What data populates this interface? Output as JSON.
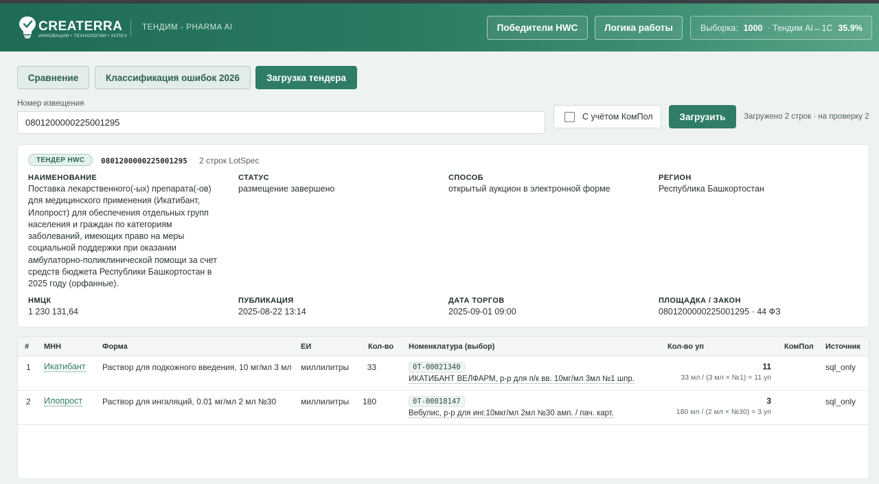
{
  "brand": {
    "logo_word": "CREATERRA",
    "logo_tagline": "ИННОВАЦИИ • ТЕХНОЛОГИИ • УСПЕХ",
    "app_subtitle": "ТЕНДИМ - PHARMA AI"
  },
  "header": {
    "winners_button": "Победители HWC",
    "logic_button": "Логика работы",
    "stats_sample_label": "Выборка:",
    "stats_sample_value": "1000",
    "stats_match_label": "· Тендим AI↔1С",
    "stats_match_value": "35.9%"
  },
  "tabs": [
    {
      "label": "Сравнение",
      "active": false
    },
    {
      "label": "Классификация ошибок 2026",
      "active": false
    },
    {
      "label": "Загрузка тендера",
      "active": true
    }
  ],
  "form": {
    "notice_label": "Номер извещения",
    "notice_value": "0801200000225001295",
    "kompol_label": "С учётом КомПол",
    "kompol_checked": false,
    "load_button": "Загрузить",
    "load_status": "Загружено 2 строк · на проверку 2"
  },
  "tender": {
    "badge": "ТЕНДЕР HWC",
    "number": "0801200000225001295",
    "rows_info": "2 строк LotSpec",
    "name_label": "НАИМЕНОВАНИЕ",
    "name_lines": [
      "Поставка лекарственного(-ых) препарата(-ов)",
      "для медицинского применения (Икатибант,",
      "Илопрост) для обеспечения отдельных групп",
      "населения и граждан по категориям",
      "заболеваний, имеющих право на меры",
      "социальной поддержки при оказании",
      "амбулаторно-поликлинической помощи за счет",
      "средств бюджета Республики Башкортостан в",
      "2025 году (орфанные)."
    ],
    "status_label": "СТАТУС",
    "status_value": "размещение завершено",
    "method_label": "СПОСОБ",
    "method_value": "открытый аукцион в электронной форме",
    "region_label": "РЕГИОН",
    "region_value": "Республика Башкортостан",
    "nmck_label": "НМЦК",
    "nmck_value": "1 230 131,64",
    "pub_label": "ПУБЛИКАЦИЯ",
    "pub_value": "2025-08-22 13:14",
    "date_label": "ДАТА ТОРГОВ",
    "date_value": "2025-09-01 09:00",
    "platform_label": "ПЛОЩАДКА / ЗАКОН",
    "platform_value": "0801200000225001295 · 44 ФЗ"
  },
  "table": {
    "headers": [
      "#",
      "МНН",
      "Форма",
      "ЕИ",
      "Кол-во",
      "Номенклатура (выбор)",
      "Кол-во уп",
      "КомПол",
      "Источник"
    ],
    "rows": [
      {
        "num": "1",
        "mnn": "Икатибант",
        "form": "Раствор для подкожного введения, 10 мг/мл 3 мл",
        "unit": "миллилитры",
        "qty": "33",
        "code": "0T-00021340",
        "nomenclature": "ИКАТИБАНТ ВЕЛФАРМ, р-р для п/к вв. 10мг/мл 3мл №1  шпр.",
        "packs": "11",
        "packs_formula": "33 мл / (3 мл × №1) = 11 уп",
        "kompol": "",
        "source": "sql_only"
      },
      {
        "num": "2",
        "mnn": "Илопрост",
        "form": "Раствор для ингаляций, 0.01 мг/мл 2 мл №30",
        "unit": "миллилитры",
        "qty": "180",
        "code": "0T-00018147",
        "nomenclature": "Вебулис, р-р для инг.10мкг/мл 2мл №30 амп. / пач. карт.",
        "packs": "3",
        "packs_formula": "180 мл / (2 мл × №30) = 3 уп",
        "kompol": "",
        "source": "sql_only"
      }
    ]
  },
  "colors": {
    "brand_green": "#2f7d67",
    "header_gradient_start": "#1f6b57",
    "header_gradient_end": "#58a586"
  }
}
